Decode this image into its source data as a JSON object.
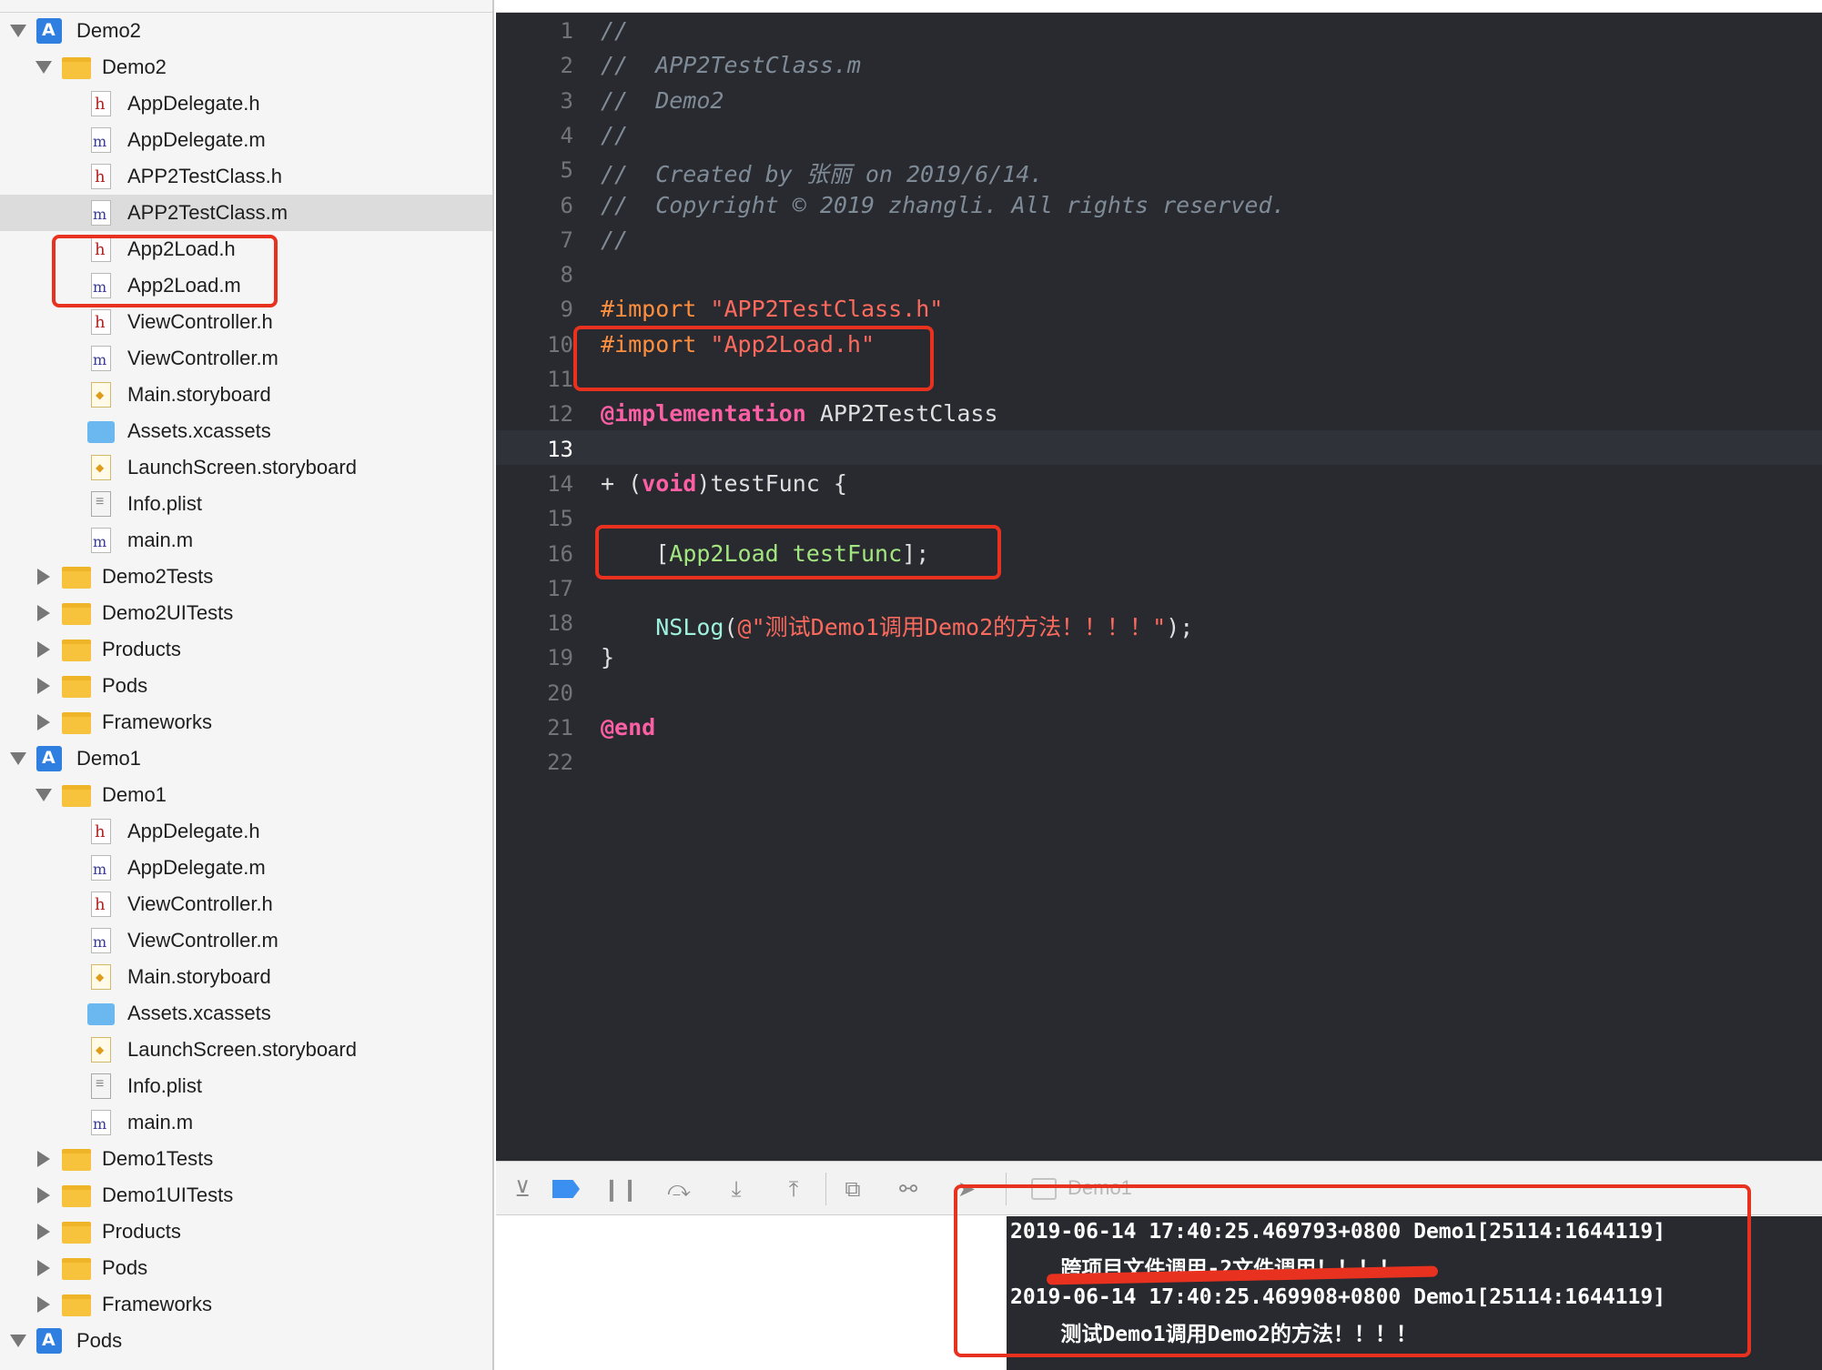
{
  "navigator": {
    "items": [
      {
        "label": "Demo2",
        "type": "project",
        "level": 0,
        "disclosure": "open"
      },
      {
        "label": "Demo2",
        "type": "folder",
        "level": 1,
        "disclosure": "open"
      },
      {
        "label": "AppDelegate.h",
        "type": "h",
        "level": 2
      },
      {
        "label": "AppDelegate.m",
        "type": "m",
        "level": 2
      },
      {
        "label": "APP2TestClass.h",
        "type": "h",
        "level": 2
      },
      {
        "label": "APP2TestClass.m",
        "type": "m",
        "level": 2,
        "selected": true
      },
      {
        "label": "App2Load.h",
        "type": "h",
        "level": 2
      },
      {
        "label": "App2Load.m",
        "type": "m",
        "level": 2
      },
      {
        "label": "ViewController.h",
        "type": "h",
        "level": 2
      },
      {
        "label": "ViewController.m",
        "type": "m",
        "level": 2
      },
      {
        "label": "Main.storyboard",
        "type": "storyboard",
        "level": 2
      },
      {
        "label": "Assets.xcassets",
        "type": "assets",
        "level": 2
      },
      {
        "label": "LaunchScreen.storyboard",
        "type": "storyboard",
        "level": 2
      },
      {
        "label": "Info.plist",
        "type": "plist",
        "level": 2
      },
      {
        "label": "main.m",
        "type": "m",
        "level": 2
      },
      {
        "label": "Demo2Tests",
        "type": "folder",
        "level": 1,
        "disclosure": "closed"
      },
      {
        "label": "Demo2UITests",
        "type": "folder",
        "level": 1,
        "disclosure": "closed"
      },
      {
        "label": "Products",
        "type": "folder",
        "level": 1,
        "disclosure": "closed"
      },
      {
        "label": "Pods",
        "type": "folder",
        "level": 1,
        "disclosure": "closed"
      },
      {
        "label": "Frameworks",
        "type": "folder",
        "level": 1,
        "disclosure": "closed"
      },
      {
        "label": "Demo1",
        "type": "project",
        "level": 0,
        "disclosure": "open"
      },
      {
        "label": "Demo1",
        "type": "folder",
        "level": 1,
        "disclosure": "open"
      },
      {
        "label": "AppDelegate.h",
        "type": "h",
        "level": 2
      },
      {
        "label": "AppDelegate.m",
        "type": "m",
        "level": 2
      },
      {
        "label": "ViewController.h",
        "type": "h",
        "level": 2
      },
      {
        "label": "ViewController.m",
        "type": "m",
        "level": 2
      },
      {
        "label": "Main.storyboard",
        "type": "storyboard",
        "level": 2
      },
      {
        "label": "Assets.xcassets",
        "type": "assets",
        "level": 2
      },
      {
        "label": "LaunchScreen.storyboard",
        "type": "storyboard",
        "level": 2
      },
      {
        "label": "Info.plist",
        "type": "plist",
        "level": 2
      },
      {
        "label": "main.m",
        "type": "m",
        "level": 2
      },
      {
        "label": "Demo1Tests",
        "type": "folder",
        "level": 1,
        "disclosure": "closed"
      },
      {
        "label": "Demo1UITests",
        "type": "folder",
        "level": 1,
        "disclosure": "closed"
      },
      {
        "label": "Products",
        "type": "folder",
        "level": 1,
        "disclosure": "closed"
      },
      {
        "label": "Pods",
        "type": "folder",
        "level": 1,
        "disclosure": "closed"
      },
      {
        "label": "Frameworks",
        "type": "folder",
        "level": 1,
        "disclosure": "closed"
      },
      {
        "label": "Pods",
        "type": "project",
        "level": 0,
        "disclosure": "open"
      }
    ]
  },
  "editor": {
    "current_line": 13,
    "lines": [
      {
        "n": "1",
        "tokens": [
          {
            "t": "//",
            "c": "cm"
          }
        ]
      },
      {
        "n": "2",
        "tokens": [
          {
            "t": "//  APP2TestClass.m",
            "c": "cm"
          }
        ]
      },
      {
        "n": "3",
        "tokens": [
          {
            "t": "//  Demo2",
            "c": "cm"
          }
        ]
      },
      {
        "n": "4",
        "tokens": [
          {
            "t": "//",
            "c": "cm"
          }
        ]
      },
      {
        "n": "5",
        "tokens": [
          {
            "t": "//  Created by 张丽 on 2019/6/14.",
            "c": "cm"
          }
        ]
      },
      {
        "n": "6",
        "tokens": [
          {
            "t": "//  Copyright © 2019 zhangli. All rights reserved.",
            "c": "cm"
          }
        ]
      },
      {
        "n": "7",
        "tokens": [
          {
            "t": "//",
            "c": "cm"
          }
        ]
      },
      {
        "n": "8",
        "tokens": []
      },
      {
        "n": "9",
        "tokens": [
          {
            "t": "#import ",
            "c": "pp"
          },
          {
            "t": "\"APP2TestClass.h\"",
            "c": "str"
          }
        ]
      },
      {
        "n": "10",
        "tokens": [
          {
            "t": "#import ",
            "c": "pp"
          },
          {
            "t": "\"App2Load.h\"",
            "c": "str"
          }
        ]
      },
      {
        "n": "11",
        "tokens": []
      },
      {
        "n": "12",
        "tokens": [
          {
            "t": "@implementation",
            "c": "kw"
          },
          {
            "t": " APP2TestClass",
            "c": ""
          }
        ]
      },
      {
        "n": "13",
        "tokens": []
      },
      {
        "n": "14",
        "tokens": [
          {
            "t": "+ (",
            "c": ""
          },
          {
            "t": "void",
            "c": "kw"
          },
          {
            "t": ")testFunc {",
            "c": ""
          }
        ]
      },
      {
        "n": "15",
        "tokens": []
      },
      {
        "n": "16",
        "tokens": [
          {
            "t": "    [",
            "c": ""
          },
          {
            "t": "App2Load",
            "c": "ext-cls"
          },
          {
            "t": " ",
            "c": ""
          },
          {
            "t": "testFunc",
            "c": "meth"
          },
          {
            "t": "];",
            "c": ""
          }
        ]
      },
      {
        "n": "17",
        "tokens": []
      },
      {
        "n": "18",
        "tokens": [
          {
            "t": "    ",
            "c": ""
          },
          {
            "t": "NSLog",
            "c": "cls"
          },
          {
            "t": "(",
            "c": ""
          },
          {
            "t": "@\"测试Demo1调用Demo2的方法！！！！\"",
            "c": "str"
          },
          {
            "t": ");",
            "c": ""
          }
        ]
      },
      {
        "n": "19",
        "tokens": [
          {
            "t": "}",
            "c": ""
          }
        ]
      },
      {
        "n": "20",
        "tokens": []
      },
      {
        "n": "21",
        "tokens": [
          {
            "t": "@end",
            "c": "kw"
          }
        ]
      },
      {
        "n": "22",
        "tokens": []
      }
    ]
  },
  "debugbar": {
    "target_label": "Demo1",
    "buttons": [
      {
        "name": "hide-debug-area-icon",
        "glyph": "⊻"
      },
      {
        "name": "breakpoints-toggle-icon",
        "glyph": ""
      },
      {
        "name": "pause-icon",
        "glyph": "❙❙"
      },
      {
        "name": "step-over-icon",
        "glyph": "⤼"
      },
      {
        "name": "step-into-icon",
        "glyph": "⤓"
      },
      {
        "name": "step-out-icon",
        "glyph": "⤒"
      },
      {
        "name": "view-debugger-icon",
        "glyph": "⧉"
      },
      {
        "name": "memory-graph-icon",
        "glyph": "⚯"
      },
      {
        "name": "location-icon",
        "glyph": "➤"
      }
    ]
  },
  "console": {
    "lines": [
      "2019-06-14 17:40:25.469793+0800 Demo1[25114:1644119]",
      "    跨项目文件调用-2文件调用！！！！",
      "2019-06-14 17:40:25.469908+0800 Demo1[25114:1644119]",
      "    测试Demo1调用Demo2的方法！！！！"
    ]
  },
  "colors": {
    "highlight": "#e8321f",
    "editor_bg": "#292a30"
  }
}
